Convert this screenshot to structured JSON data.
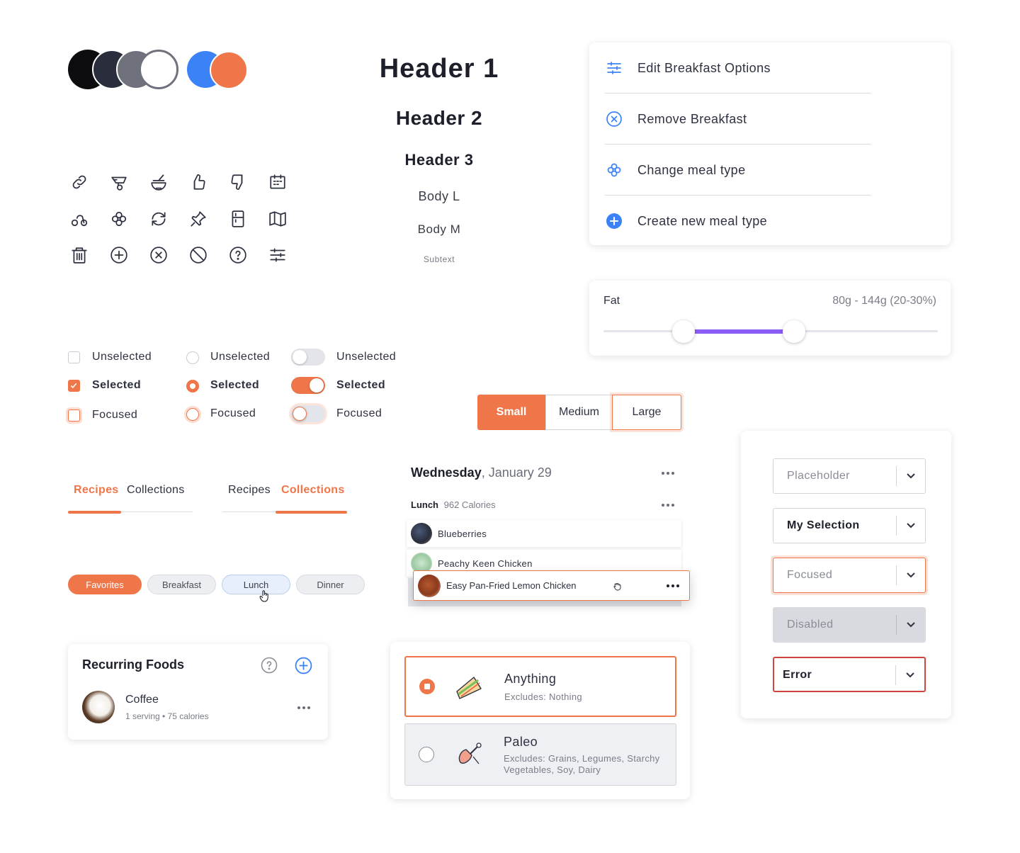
{
  "palette": {
    "colors": [
      "#0d0d0f",
      "#2a2d3b",
      "#6f717c",
      "#ffffff",
      "#3b82f6",
      "#ef7649"
    ]
  },
  "typography": {
    "header1": "Header 1",
    "header2": "Header 2",
    "header3": "Header 3",
    "body_l": "Body L",
    "body_m": "Body M",
    "subtext": "Subtext"
  },
  "icons": [
    "link-icon",
    "blender-icon",
    "bowl-icon",
    "thumbs-up-icon",
    "thumbs-down-icon",
    "calendar-icon",
    "scooter-icon",
    "flower-icon",
    "refresh-icon",
    "pin-icon",
    "fridge-icon",
    "map-icon",
    "trash-icon",
    "add-circle-icon",
    "close-circle-icon",
    "block-icon",
    "help-icon",
    "sliders-icon"
  ],
  "menu": {
    "items": [
      {
        "label": "Edit Breakfast Options",
        "icon": "sliders-icon"
      },
      {
        "label": "Remove Breakfast",
        "icon": "close-circle-icon"
      },
      {
        "label": "Change meal type",
        "icon": "flower-icon"
      },
      {
        "label": "Create new meal type",
        "icon": "add-circle-filled-icon"
      }
    ]
  },
  "range": {
    "label": "Fat",
    "value_text": "80g - 144g (20-30%)",
    "low_fraction": 0.24,
    "high_fraction": 0.57,
    "accent": "#8b5cf6"
  },
  "controls": {
    "checkbox": {
      "unselected": "Unselected",
      "selected": "Selected",
      "focused": "Focused"
    },
    "radio": {
      "unselected": "Unselected",
      "selected": "Selected",
      "focused": "Focused"
    },
    "toggle": {
      "unselected": "Unselected",
      "selected": "Selected",
      "focused": "Focused"
    }
  },
  "segmented": {
    "options": [
      "Small",
      "Medium",
      "Large"
    ],
    "selected": "Small"
  },
  "tabs": {
    "set1": {
      "items": [
        "Recipes",
        "Collections"
      ],
      "active": "Recipes"
    },
    "set2": {
      "items": [
        "Recipes",
        "Collections"
      ],
      "active": "Collections"
    }
  },
  "pills": {
    "items": [
      "Favorites",
      "Breakfast",
      "Lunch",
      "Dinner"
    ]
  },
  "day": {
    "weekday": "Wednesday",
    "date": ", January 29",
    "meal": "Lunch",
    "calories": "962 Calories",
    "foods": [
      "Blueberries",
      "Peachy Keen Chicken",
      "Easy Pan-Fried Lemon Chicken"
    ]
  },
  "dropdowns": {
    "placeholder": "Placeholder",
    "selection": "My Selection",
    "focused": "Focused",
    "disabled": "Disabled",
    "error": "Error"
  },
  "recurring": {
    "title": "Recurring Foods",
    "item_name": "Coffee",
    "item_detail": "1 serving • 75 calories"
  },
  "diets": [
    {
      "title": "Anything",
      "excludes": "Excludes: Nothing",
      "selected": true
    },
    {
      "title": "Paleo",
      "excludes": "Excludes: Grains, Legumes, Starchy Vegetables, Soy, Dairy",
      "selected": false
    }
  ]
}
